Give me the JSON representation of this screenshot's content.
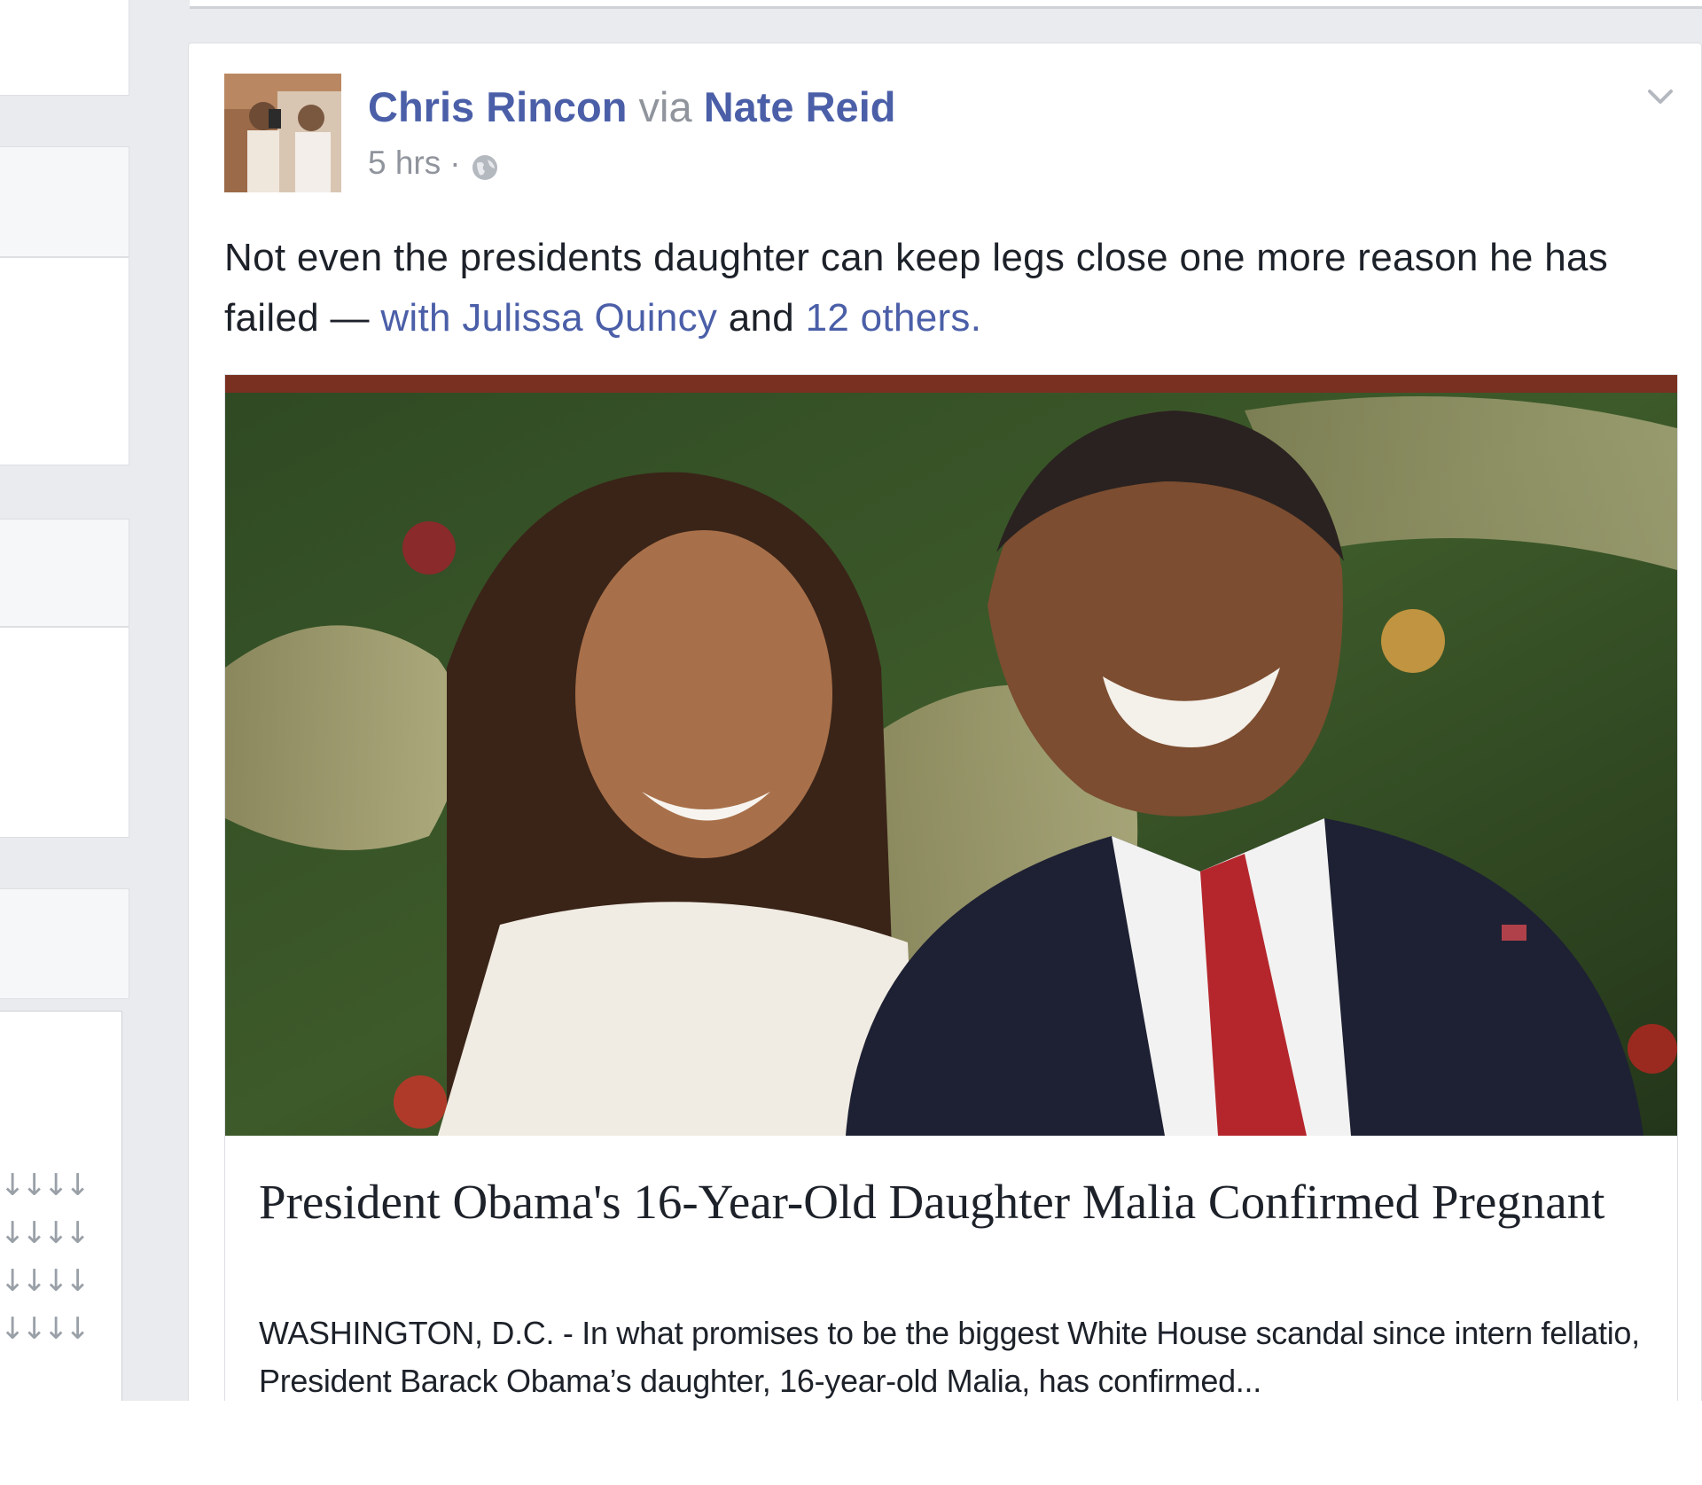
{
  "post": {
    "author": "Chris Rincon",
    "via_label": "via",
    "via_author": "Nate Reid",
    "timestamp": "5 hrs",
    "separator": "·",
    "text_main": "Not even the presidents daughter can keep legs close one more reason he has failed",
    "text_dash": " — ",
    "with_label": "with",
    "tagged_person": "Julissa Quincy",
    "and_label": "and",
    "others_label": "12 others",
    "text_period": ".",
    "link": {
      "title": "President Obama's 16-Year-Old Daughter Malia Confirmed Pregnant",
      "description": "WASHINGTON, D.C. - In what promises to be the biggest White House scandal since intern fellatio, President Barack Obama’s daughter, 16-year-old Malia, has confirmed..."
    }
  },
  "left_column": {
    "arrows": "↓↓↓↓\n↓↓↓↓\n↓↓↓↓\n↓↓↓↓"
  },
  "colors": {
    "link_blue": "#4b5fa8",
    "meta_grey": "#90949c",
    "feed_bg": "#e9ebee",
    "text": "#1d2129"
  },
  "icons": {
    "audience": "globe-icon",
    "post_options": "chevron-down-icon"
  }
}
